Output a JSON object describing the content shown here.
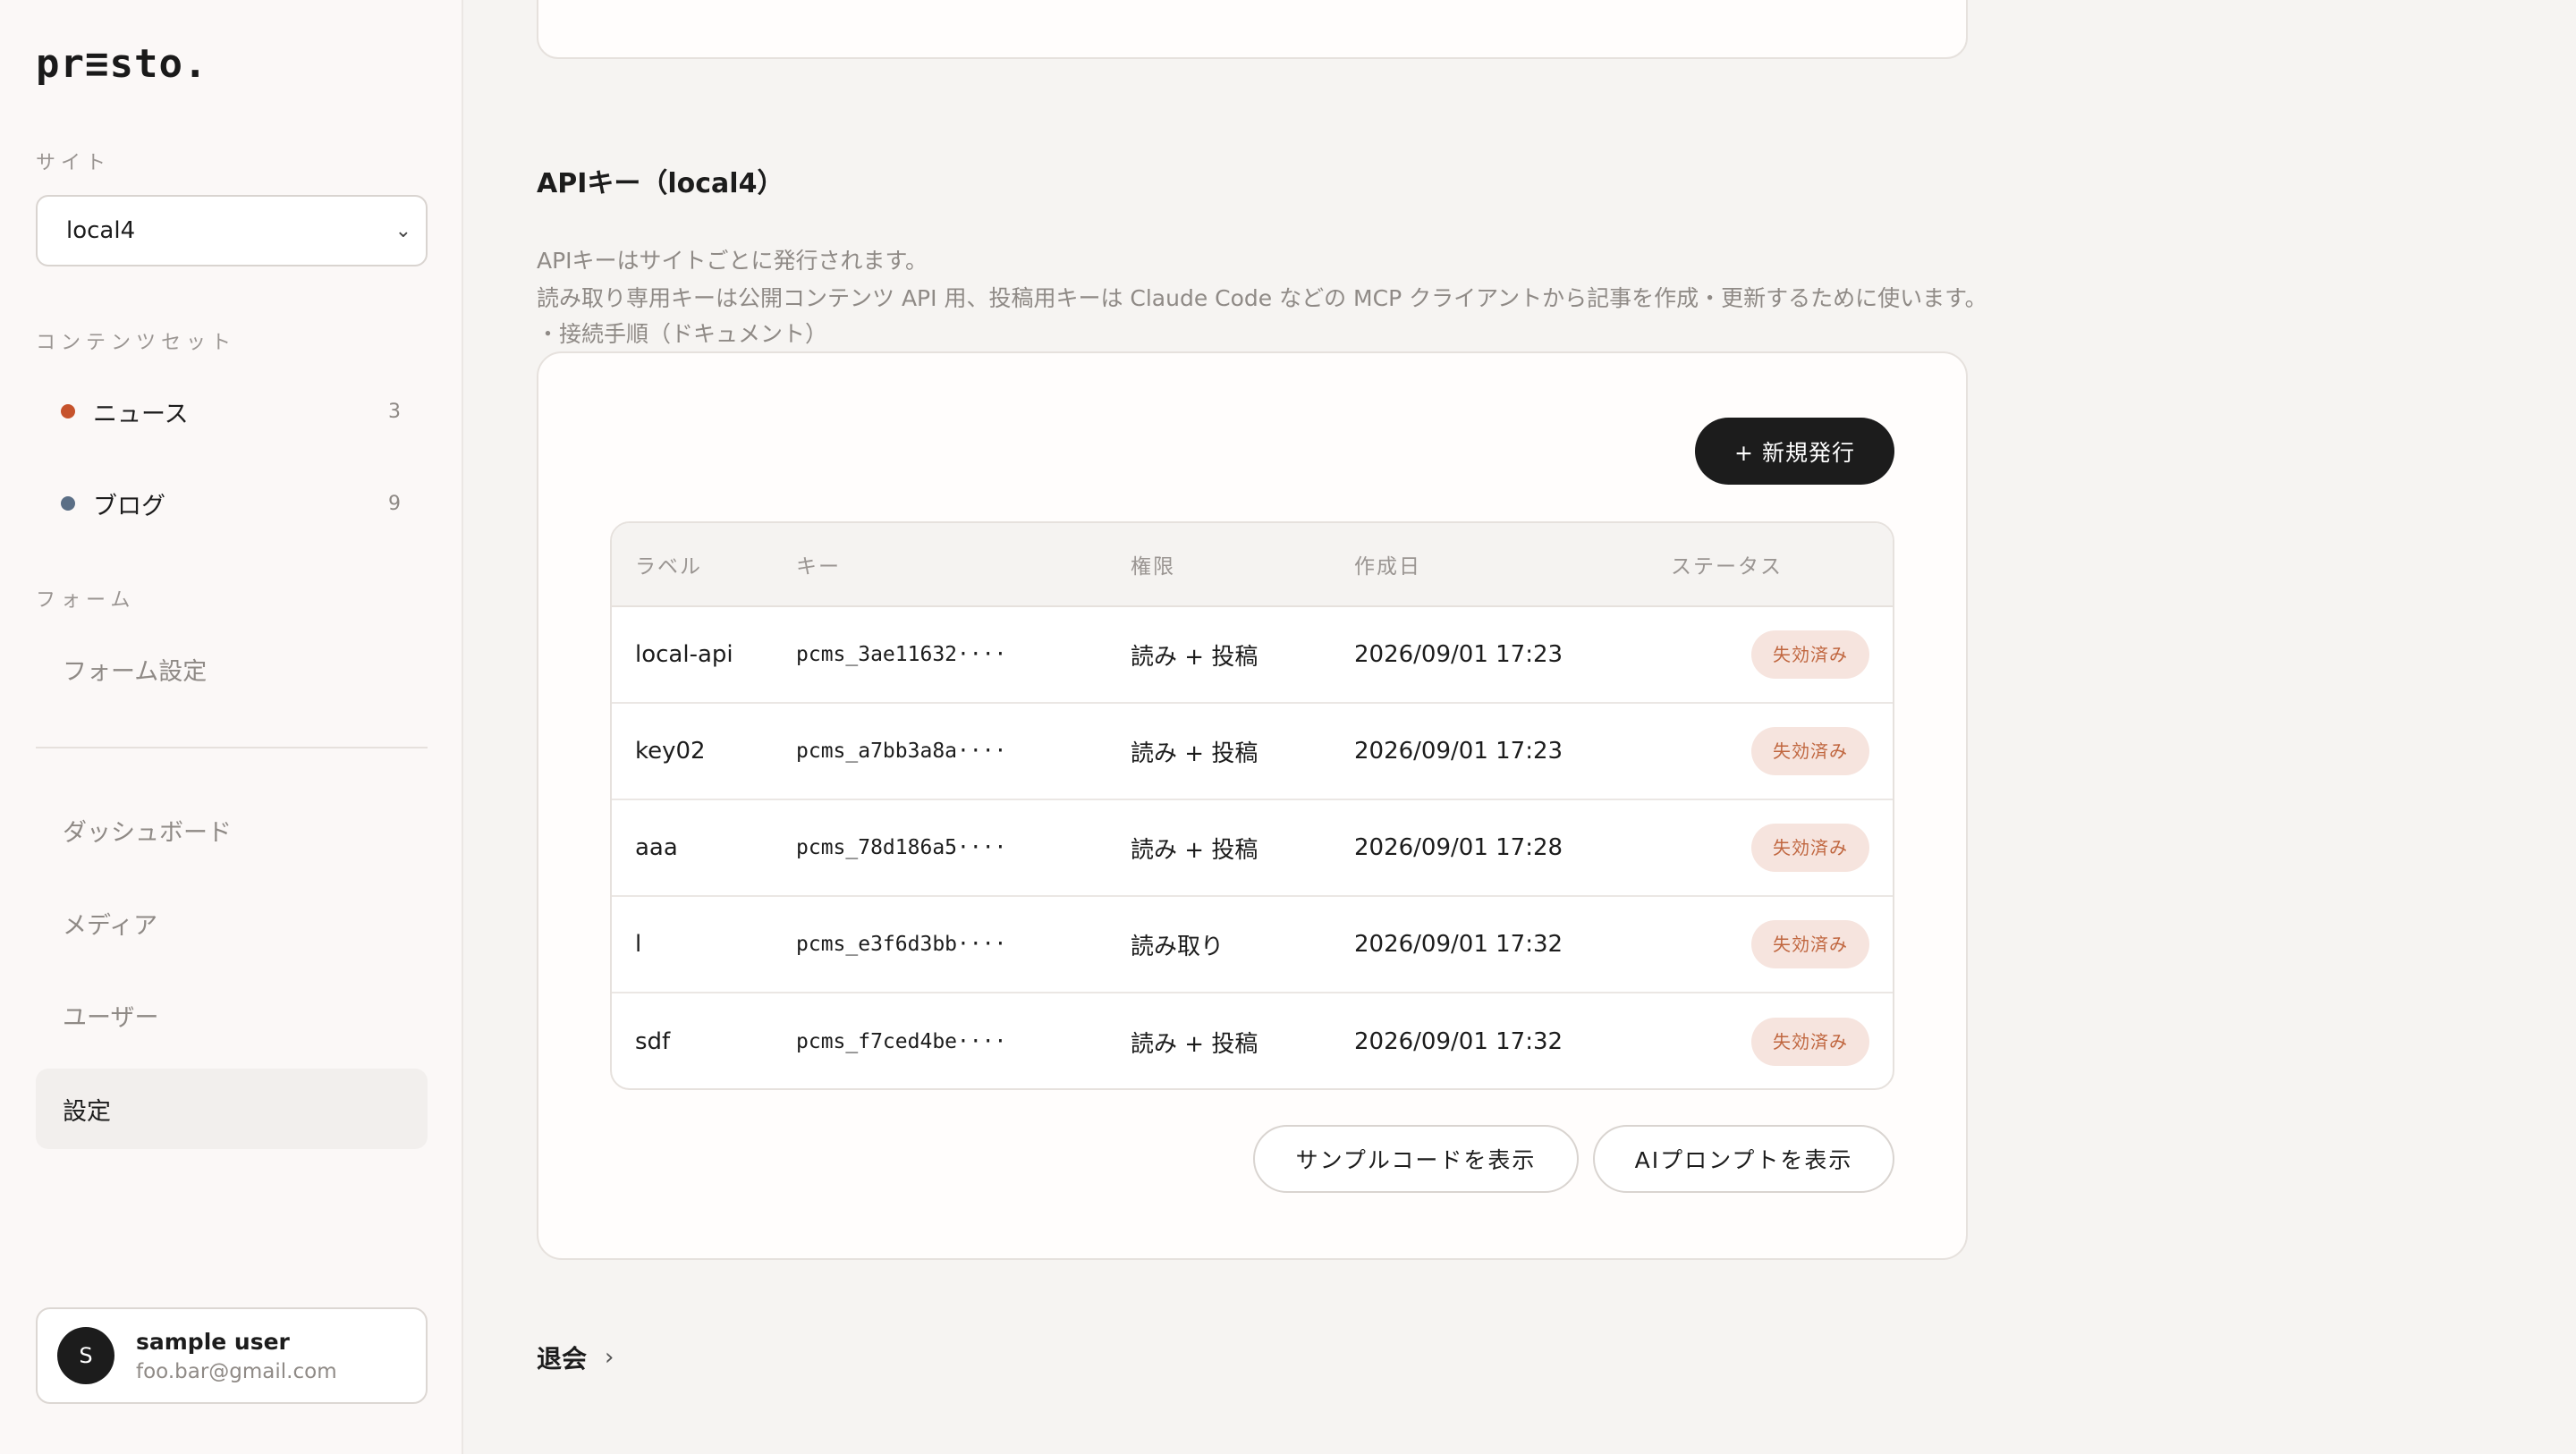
{
  "sidebar": {
    "logo": "pr≡sto.",
    "site_label": "サイト",
    "site_value": "local4",
    "content_label": "コンテンツセット",
    "content_sets": [
      {
        "label": "ニュース",
        "count": "3",
        "color": "#c6532c"
      },
      {
        "label": "ブログ",
        "count": "9",
        "color": "#5b6f86"
      }
    ],
    "form_label": "フォーム",
    "form_item": "フォーム設定",
    "nav": [
      {
        "label": "ダッシュボード"
      },
      {
        "label": "メディア"
      },
      {
        "label": "ユーザー"
      },
      {
        "label": "設定"
      }
    ],
    "user": {
      "initial": "S",
      "name": "sample user",
      "email": "foo.bar@gmail.com"
    }
  },
  "main": {
    "title": "APIキー（local4）",
    "desc1": "APIキーはサイトごとに発行されます。",
    "desc2": "読み取り専用キーは公開コンテンツ API 用、投稿用キーは Claude Code などの MCP クライアントから記事を作成・更新するために使います。",
    "desc3": "・接続手順（ドキュメント）",
    "new_button": "+ 新規発行",
    "columns": [
      "ラベル",
      "キー",
      "権限",
      "作成日",
      "ステータス"
    ],
    "rows": [
      {
        "label": "local-api",
        "key": "pcms_3ae11632····",
        "perm": "読み + 投稿",
        "date": "2026/09/01 17:23",
        "status": "失効済み"
      },
      {
        "label": "key02",
        "key": "pcms_a7bb3a8a····",
        "perm": "読み + 投稿",
        "date": "2026/09/01 17:23",
        "status": "失効済み"
      },
      {
        "label": "aaa",
        "key": "pcms_78d186a5····",
        "perm": "読み + 投稿",
        "date": "2026/09/01 17:28",
        "status": "失効済み"
      },
      {
        "label": "l",
        "key": "pcms_e3f6d3bb····",
        "perm": "読み取り",
        "date": "2026/09/01 17:32",
        "status": "失効済み"
      },
      {
        "label": "sdf",
        "key": "pcms_f7ced4be····",
        "perm": "読み + 投稿",
        "date": "2026/09/01 17:32",
        "status": "失効済み"
      }
    ],
    "sample_code_button": "サンプルコードを表示",
    "ai_prompt_button": "AIプロンプトを表示",
    "withdraw_label": "退会"
  }
}
